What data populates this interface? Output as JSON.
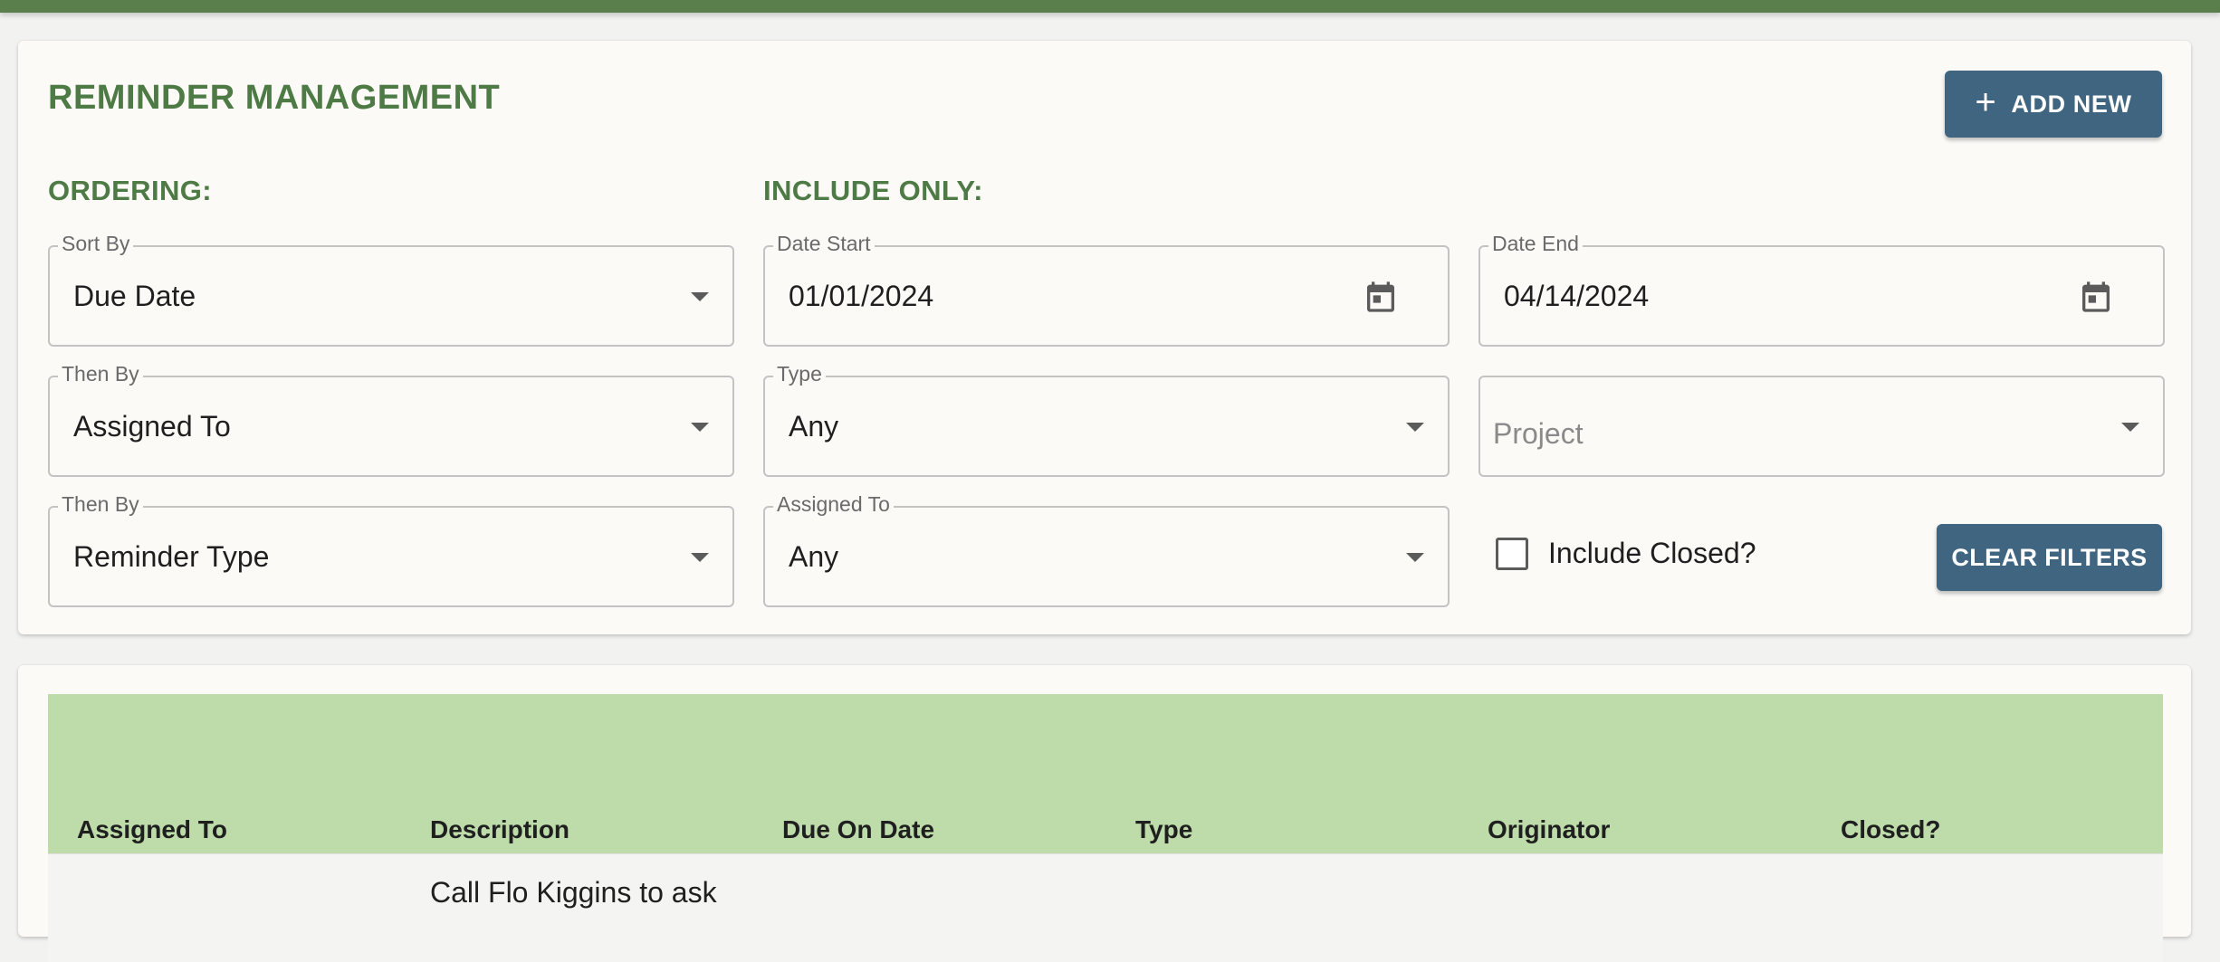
{
  "header": {
    "title": "REMINDER MANAGEMENT",
    "add_new_label": "ADD NEW"
  },
  "ordering": {
    "label": "ORDERING:",
    "sort_by": {
      "label": "Sort By",
      "value": "Due Date"
    },
    "then_by_1": {
      "label": "Then By",
      "value": "Assigned To"
    },
    "then_by_2": {
      "label": "Then By",
      "value": "Reminder Type"
    }
  },
  "include_only": {
    "label": "INCLUDE ONLY:",
    "date_start": {
      "label": "Date Start",
      "value": "01/01/2024"
    },
    "date_end": {
      "label": "Date End",
      "value": "04/14/2024"
    },
    "type": {
      "label": "Type",
      "value": "Any"
    },
    "project": {
      "placeholder": "Project"
    },
    "assigned_to": {
      "label": "Assigned To",
      "value": "Any"
    },
    "include_closed_label": "Include Closed?",
    "include_closed_checked": false,
    "clear_filters_label": "CLEAR FILTERS"
  },
  "table": {
    "columns": [
      "Assigned To",
      "Description",
      "Due On Date",
      "Type",
      "Originator",
      "Closed?"
    ],
    "rows": [
      {
        "assigned_to": "",
        "description": "Call Flo Kiggins to ask",
        "due_on_date": "",
        "type": "",
        "originator": "",
        "closed": ""
      }
    ]
  },
  "colors": {
    "accent_green": "#4d7a45",
    "top_bar": "#5a7f4c",
    "button_blue": "#3f6580",
    "table_header": "#bddcaa"
  }
}
